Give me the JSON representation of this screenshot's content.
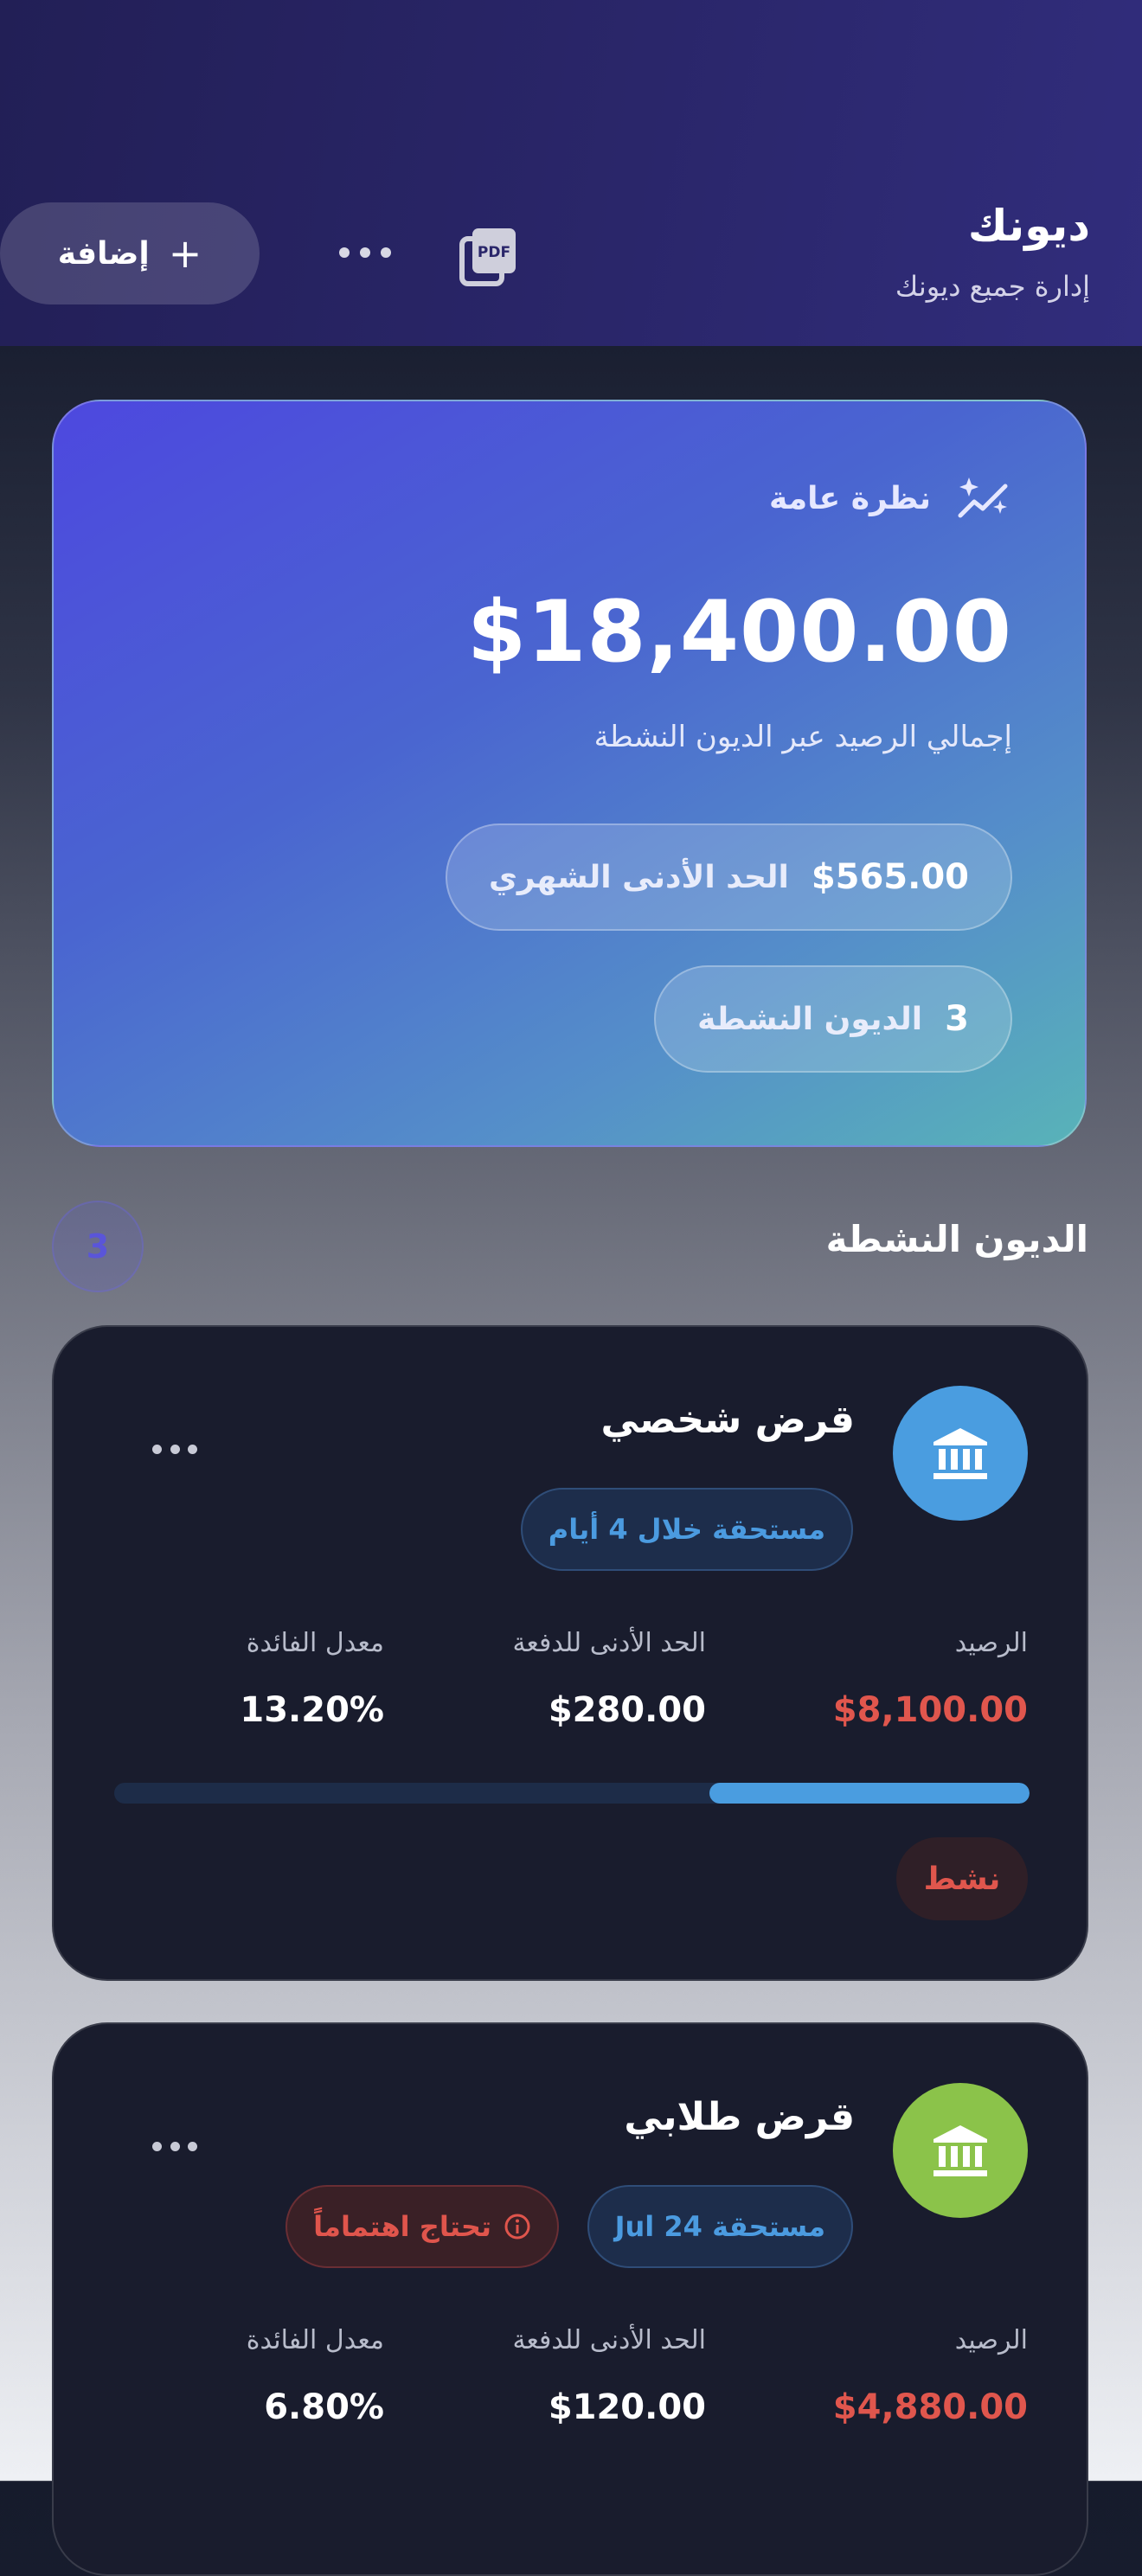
{
  "header": {
    "title": "ديونك",
    "subtitle": "إدارة جميع ديونك",
    "add_label": "إضافة",
    "pdf_icon": "pdf-export-icon",
    "more_icon": "ellipsis-icon",
    "bg_color": "#2a266a"
  },
  "overview": {
    "label": "نظرة عامة",
    "icon": "sparkle-trend-icon",
    "total_amount": "$18,400.00",
    "caption": "إجمالي الرصيد عبر الديون النشطة",
    "monthly_min_value": "$565.00",
    "monthly_min_label": "الحد الأدنى الشهري",
    "active_count_value": "3",
    "active_count_label": "الديون النشطة"
  },
  "section": {
    "title": "الديون النشطة",
    "count": "3"
  },
  "debts": [
    {
      "name": "قرض شخصي",
      "icon": "bank-icon",
      "icon_color": "#4a9de0",
      "due_badge": "مستحقة خلال 4 أيام",
      "balance_label": "الرصيد",
      "balance_value": "$8,100.00",
      "min_payment_label": "الحد الأدنى للدفعة",
      "min_payment_value": "$280.00",
      "interest_label": "معدل الفائدة",
      "interest_value": "13.20%",
      "progress": 0.35,
      "status": "نشط"
    },
    {
      "name": "قرض طلابي",
      "icon": "bank-icon",
      "icon_color": "#8bc34a",
      "due_badge": "مستحقة Jul 24",
      "attention_badge": "تحتاج اهتماماً",
      "attention_icon": "info-circle-icon",
      "balance_label": "الرصيد",
      "balance_value": "$4,880.00",
      "min_payment_label": "الحد الأدنى للدفعة",
      "min_payment_value": "$120.00",
      "interest_label": "معدل الفائدة",
      "interest_value": "6.80%"
    }
  ]
}
